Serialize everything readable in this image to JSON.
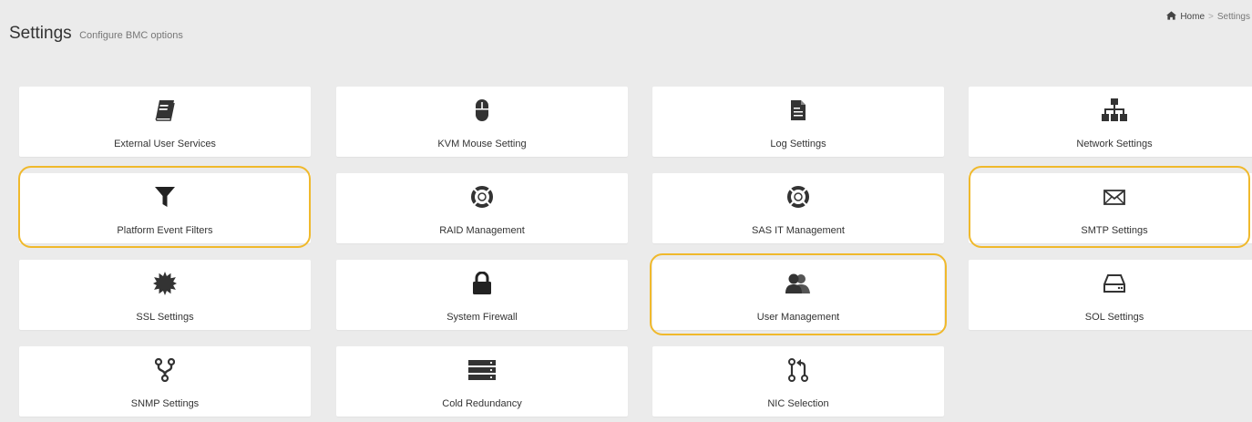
{
  "header": {
    "title": "Settings",
    "subtitle": "Configure BMC options"
  },
  "breadcrumb": {
    "home_icon": "home-icon",
    "home": "Home",
    "separator": ">",
    "current": "Settings"
  },
  "highlight_color": "#f0b92c",
  "cards": [
    {
      "label": "External User Services",
      "icon": "book-icon",
      "highlighted": false
    },
    {
      "label": "KVM Mouse Setting",
      "icon": "mouse-icon",
      "highlighted": false
    },
    {
      "label": "Log Settings",
      "icon": "file-text-icon",
      "highlighted": false
    },
    {
      "label": "Network Settings",
      "icon": "sitemap-icon",
      "highlighted": false
    },
    {
      "label": "Platform Event Filters",
      "icon": "filter-icon",
      "highlighted": true
    },
    {
      "label": "RAID Management",
      "icon": "lifebuoy-icon",
      "highlighted": false
    },
    {
      "label": "SAS IT Management",
      "icon": "lifebuoy-icon",
      "highlighted": false
    },
    {
      "label": "SMTP Settings",
      "icon": "envelope-icon",
      "highlighted": true
    },
    {
      "label": "SSL Settings",
      "icon": "certificate-icon",
      "highlighted": false
    },
    {
      "label": "System Firewall",
      "icon": "lock-icon",
      "highlighted": false
    },
    {
      "label": "User Management",
      "icon": "users-icon",
      "highlighted": true
    },
    {
      "label": "SOL Settings",
      "icon": "hdd-icon",
      "highlighted": false
    },
    {
      "label": "SNMP Settings",
      "icon": "code-fork-icon",
      "highlighted": false
    },
    {
      "label": "Cold Redundancy",
      "icon": "server-icon",
      "highlighted": false
    },
    {
      "label": "NIC Selection",
      "icon": "git-pull-request-icon",
      "highlighted": false
    }
  ]
}
